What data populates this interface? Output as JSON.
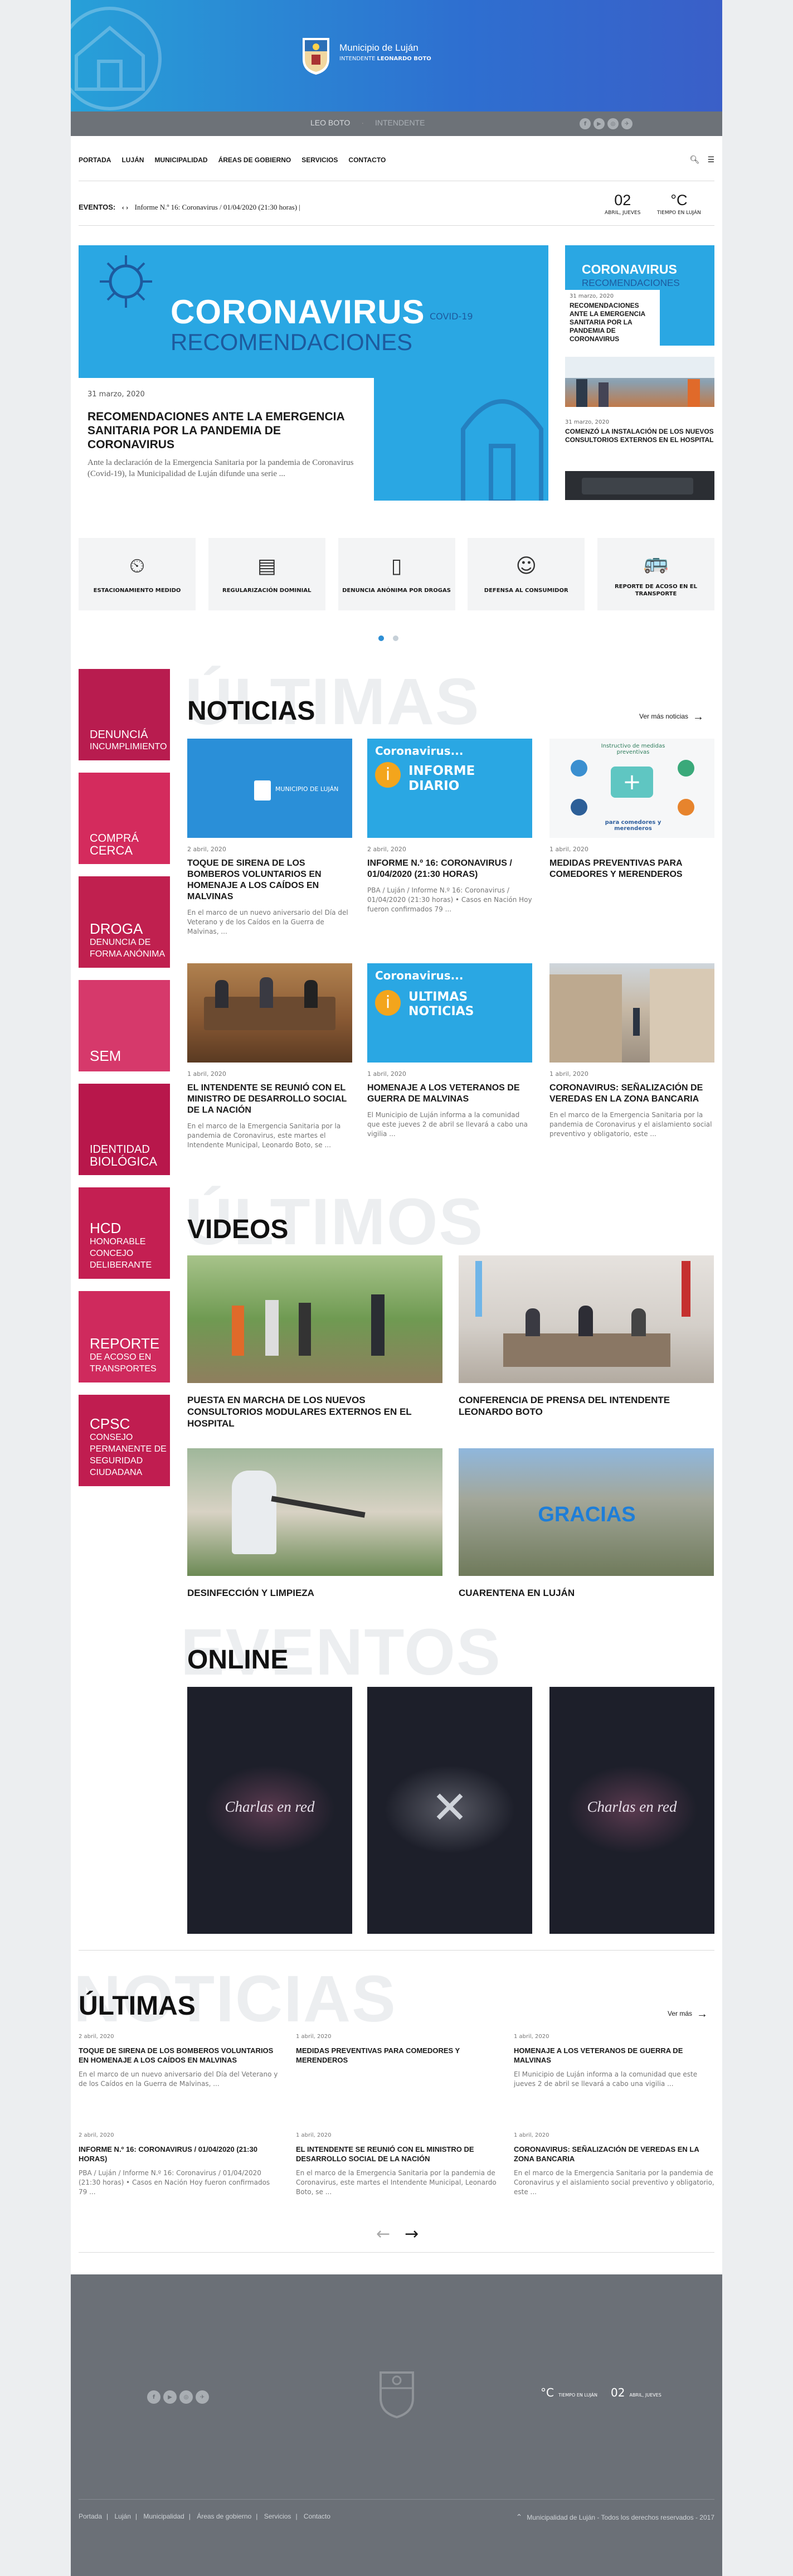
{
  "header": {
    "brand_title": "Municipio de Luján",
    "brand_sub_label": "INTENDENTE",
    "brand_sub_name": "LEONARDO BOTO",
    "bar_name_active": "LEO BOTO",
    "bar_name_role": "INTENDENTE",
    "social": [
      "f",
      "▶",
      "◎",
      "✈"
    ]
  },
  "nav": {
    "items": [
      "PORTADA",
      "LUJÁN",
      "MUNICIPALIDAD",
      "ÁREAS DE GOBIERNO",
      "SERVICIOS",
      "CONTACTO"
    ]
  },
  "events": {
    "label": "EVENTOS:",
    "text": "Informe N.º 16: Coronavirus / 01/04/2020 (21:30 horas)",
    "day": "02",
    "day_label": "ABRIL, JUEVES",
    "temp": "°C",
    "temp_label": "TIEMPO EN LUJÁN"
  },
  "featured": {
    "banner_title": "CORONAVIRUS",
    "banner_sub": "RECOMENDACIONES",
    "banner_tag": "COVID-19",
    "date": "31 marzo, 2020",
    "title": "RECOMENDACIONES ANTE LA EMERGENCIA SANITARIA POR LA PANDEMIA DE CORONAVIRUS",
    "excerpt": "Ante la declaración de la Emergencia Sanitaria por la pandemia de Coronavirus (Covid-19), la Municipalidad de Luján difunde una serie ..."
  },
  "sidebar_news": [
    {
      "thumb_title": "CORONAVIRUS",
      "thumb_sub": "RECOMENDACIONES",
      "date": "31 marzo, 2020",
      "title": "RECOMENDACIONES ANTE LA EMERGENCIA SANITARIA POR LA PANDEMIA DE CORONAVIRUS"
    },
    {
      "date": "31 marzo, 2020",
      "title": "COMENZÓ LA INSTALACIÓN DE LOS NUEVOS CONSULTORIOS EXTERNOS EN EL HOSPITAL"
    }
  ],
  "services": [
    {
      "icon": "⏲",
      "label": "ESTACIONAMIENTO MEDIDO"
    },
    {
      "icon": "▤",
      "label": "REGULARIZACIÓN DOMINIAL"
    },
    {
      "icon": "▯",
      "label": "DENUNCIA ANÓNIMA POR DROGAS"
    },
    {
      "icon": "☺",
      "label": "DEFENSA AL CONSUMIDOR"
    },
    {
      "icon": "🚌",
      "label": "REPORTE DE ACOSO EN EL TRANSPORTE"
    }
  ],
  "tiles": [
    {
      "title": "DENUNCIÁ",
      "sub": "INCUMPLIMIENTO"
    },
    {
      "title": "COMPRÁ",
      "sub": "CERCA"
    },
    {
      "title": "DROGA",
      "sub": "DENUNCIA DE FORMA ANÓNIMA"
    },
    {
      "title": "SEM",
      "sub": ""
    },
    {
      "title": "IDENTIDAD",
      "sub": "BIOLÓGICA"
    },
    {
      "title": "HCD",
      "sub": "HONORABLE CONCEJO DELIBERANTE"
    },
    {
      "title": "REPORTE",
      "sub": "DE ACOSO EN TRANSPORTES"
    },
    {
      "title": "CPSC",
      "sub": "CONSEJO PERMANENTE DE SEGURIDAD CIUDADANA"
    }
  ],
  "latest": {
    "ghost": "ÚLTIMAS",
    "title": "NOTICIAS",
    "more": "Ver más noticias",
    "items": [
      {
        "date": "2 abril, 2020",
        "title": "TOQUE DE SIRENA DE LOS BOMBEROS VOLUNTARIOS EN HOMENAJE A LOS CAÍDOS EN MALVINAS",
        "excerpt": "En el marco de un nuevo aniversario del Día del Veterano y de los Caídos en la Guerra de Malvinas, ...",
        "img_text": "MUNICIPIO DE LUJÁN"
      },
      {
        "date": "2 abril, 2020",
        "title": "INFORME N.º 16: CORONAVIRUS / 01/04/2020 (21:30 HORAS)",
        "excerpt": "PBA / Luján / Informe N.º 16: Coronavirus / 01/04/2020 (21:30 horas) • Casos en Nación Hoy fueron confirmados 79 ...",
        "img_text": "INFORME DIARIO",
        "img_top": "Coronavirus..."
      },
      {
        "date": "1 abril, 2020",
        "title": "MEDIDAS PREVENTIVAS PARA COMEDORES Y MERENDEROS",
        "excerpt": "",
        "img_text": "Instructivo de medidas preventivas",
        "img_bottom": "para comedores y merenderos"
      },
      {
        "date": "1 abril, 2020",
        "title": "EL INTENDENTE SE REUNIÓ CON EL MINISTRO DE DESARROLLO SOCIAL DE LA NACIÓN",
        "excerpt": "En el marco de la Emergencia Sanitaria por la pandemia de Coronavirus, este martes el Intendente Municipal, Leonardo Boto, se ..."
      },
      {
        "date": "1 abril, 2020",
        "title": "HOMENAJE A LOS VETERANOS DE GUERRA DE MALVINAS",
        "excerpt": "El Municipio de Luján informa a la comunidad que este jueves 2 de abril se llevará a cabo una vigilia ...",
        "img_text": "ULTIMAS NOTICIAS",
        "img_top": "Coronavirus..."
      },
      {
        "date": "1 abril, 2020",
        "title": "CORONAVIRUS: SEÑALIZACIÓN DE VEREDAS EN LA ZONA BANCARIA",
        "excerpt": "En el marco de la Emergencia Sanitaria por la pandemia de Coronavirus y el aislamiento social preventivo y obligatorio, este ..."
      }
    ]
  },
  "videos": {
    "ghost": "ÚLTIMOS",
    "title": "VIDEOS",
    "items": [
      {
        "title": "PUESTA EN MARCHA DE LOS NUEVOS CONSULTORIOS MODULARES EXTERNOS EN EL HOSPITAL"
      },
      {
        "title": "CONFERENCIA DE PRENSA DEL INTENDENTE LEONARDO BOTO"
      },
      {
        "title": "DESINFECCIÓN Y LIMPIEZA"
      },
      {
        "title": "CUARENTENA EN LUJÁN",
        "overlay": "GRACIAS"
      }
    ]
  },
  "online": {
    "ghost": "EVENTOS",
    "title": "ONLINE",
    "items": [
      "Charlas en red",
      "",
      "Charlas en red"
    ]
  },
  "bottom_news": {
    "ghost": "NOTICIAS",
    "title": "ÚLTIMAS",
    "more": "Ver más",
    "items": [
      {
        "date": "2 abril, 2020",
        "title": "TOQUE DE SIRENA DE LOS BOMBEROS VOLUNTARIOS EN HOMENAJE A LOS CAÍDOS EN MALVINAS",
        "excerpt": "En el marco de un nuevo aniversario del Día del Veterano y de los Caídos en la Guerra de Malvinas, ..."
      },
      {
        "date": "1 abril, 2020",
        "title": "MEDIDAS PREVENTIVAS PARA COMEDORES Y MERENDEROS",
        "excerpt": ""
      },
      {
        "date": "1 abril, 2020",
        "title": "HOMENAJE A LOS VETERANOS DE GUERRA DE MALVINAS",
        "excerpt": "El Municipio de Luján informa a la comunidad que este jueves 2 de abril se llevará a cabo una vigilia ..."
      },
      {
        "date": "2 abril, 2020",
        "title": "INFORME N.º 16: CORONAVIRUS / 01/04/2020 (21:30 HORAS)",
        "excerpt": "PBA / Luján / Informe N.º 16: Coronavirus / 01/04/2020 (21:30 horas) • Casos en Nación Hoy fueron confirmados 79 ..."
      },
      {
        "date": "1 abril, 2020",
        "title": "EL INTENDENTE SE REUNIÓ CON EL MINISTRO DE DESARROLLO SOCIAL DE LA NACIÓN",
        "excerpt": "En el marco de la Emergencia Sanitaria por la pandemia de Coronavirus, este martes el Intendente Municipal, Leonardo Boto, se ..."
      },
      {
        "date": "1 abril, 2020",
        "title": "CORONAVIRUS: SEÑALIZACIÓN DE VEREDAS EN LA ZONA BANCARIA",
        "excerpt": "En el marco de la Emergencia Sanitaria por la pandemia de Coronavirus y el aislamiento social preventivo y obligatorio, este ..."
      }
    ],
    "prev": "←",
    "next": "→"
  },
  "footer": {
    "temp": "°C",
    "temp_label": "TIEMPO EN LUJÁN",
    "day": "02",
    "day_label": "ABRIL, JUEVES",
    "links": [
      "Portada",
      "Luján",
      "Municipalidad",
      "Áreas de gobierno",
      "Servicios",
      "Contacto"
    ],
    "copyright": "Municipalidad de Luján - Todos los derechos reservados - 2017"
  },
  "colors": {
    "accent_blue": "#2aa7e3",
    "tile_magenta": "#c21e53",
    "bar_gray": "#6d7278"
  }
}
